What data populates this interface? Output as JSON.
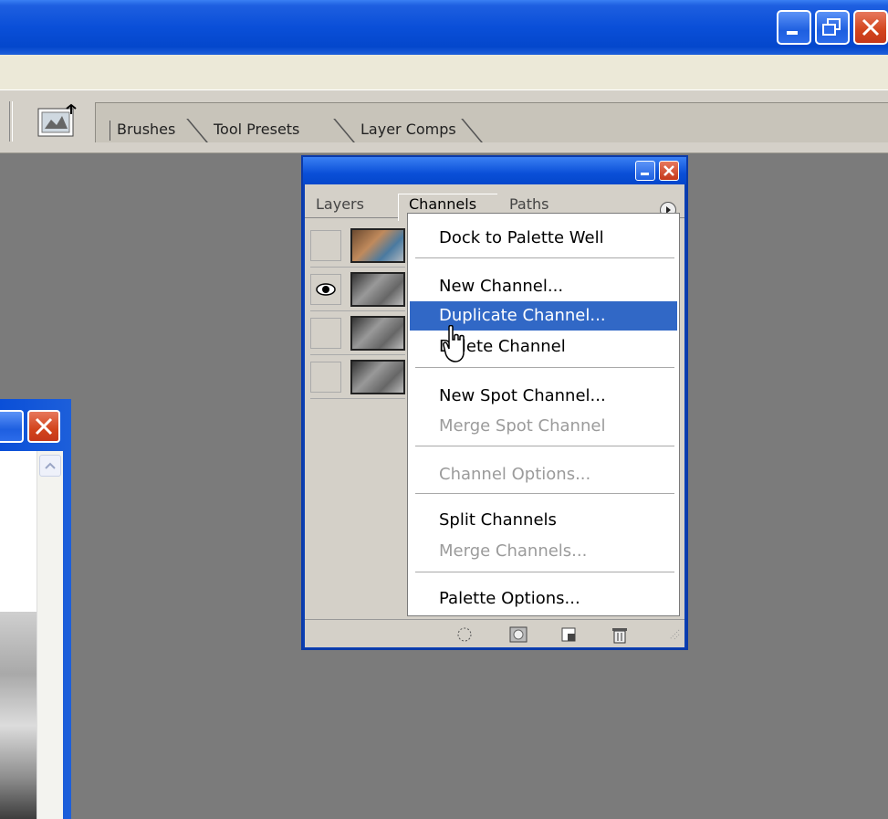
{
  "window": {
    "controls": [
      "minimize",
      "restore",
      "close"
    ]
  },
  "palette_well": {
    "tabs": [
      {
        "label": "Brushes"
      },
      {
        "label": "Tool Presets"
      },
      {
        "label": "Layer Comps"
      }
    ]
  },
  "channels_palette": {
    "tabs": [
      {
        "label": "Layers"
      },
      {
        "label": "Channels",
        "active": true
      },
      {
        "label": "Paths"
      }
    ],
    "channels": [
      {
        "visible": false,
        "thumb": "color"
      },
      {
        "visible": true,
        "thumb": "gray"
      },
      {
        "visible": false,
        "thumb": "gray"
      },
      {
        "visible": false,
        "thumb": "gray"
      }
    ]
  },
  "context_menu": {
    "items": [
      {
        "label": "Dock to Palette Well",
        "enabled": true
      },
      {
        "label": "New Channel...",
        "enabled": true
      },
      {
        "label": "Duplicate Channel...",
        "enabled": true,
        "highlighted": true
      },
      {
        "label": "Delete Channel",
        "enabled": true
      },
      {
        "label": "New Spot Channel...",
        "enabled": true
      },
      {
        "label": "Merge Spot Channel",
        "enabled": false
      },
      {
        "label": "Channel Options...",
        "enabled": false
      },
      {
        "label": "Split Channels",
        "enabled": true
      },
      {
        "label": "Merge Channels...",
        "enabled": false
      },
      {
        "label": "Palette Options...",
        "enabled": true
      }
    ]
  },
  "colors": {
    "titlebar": "#0a4fd8",
    "highlight": "#3168c6",
    "workspace": "#7b7b7b"
  },
  "icons": [
    "minimize-icon",
    "restore-icon",
    "close-icon",
    "palette-well-icon",
    "eye-icon",
    "palette-menu-icon",
    "load-selection-icon",
    "save-selection-icon",
    "new-channel-icon",
    "trash-icon",
    "resize-grip-icon",
    "scroll-up-icon",
    "cursor-icon"
  ]
}
